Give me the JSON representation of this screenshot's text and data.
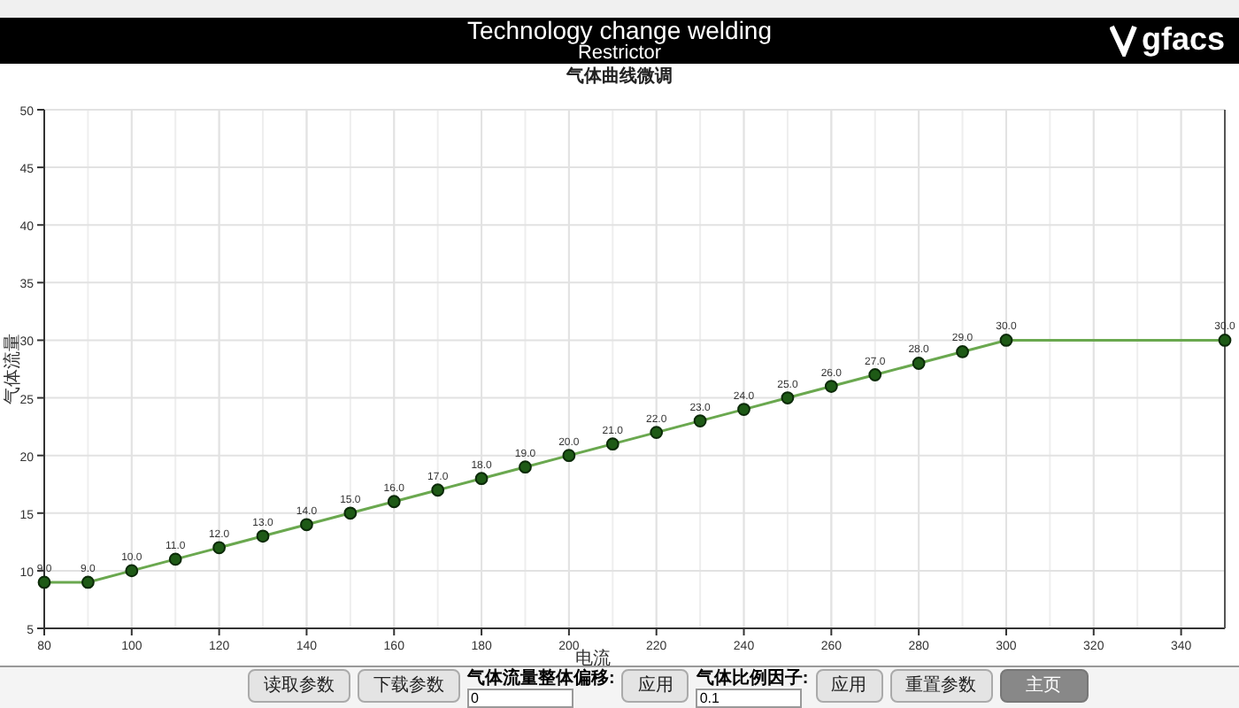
{
  "header": {
    "title": "Technology change welding",
    "subtitle": "Restrictor",
    "logo": "gfacs"
  },
  "chart": {
    "title": "气体曲线微调",
    "chart_data": {
      "type": "line",
      "xlabel": "电流",
      "ylabel": "气体流量",
      "xlim": [
        80,
        350
      ],
      "ylim": [
        5,
        50
      ],
      "xticks": [
        80,
        100,
        120,
        140,
        160,
        180,
        200,
        220,
        240,
        260,
        280,
        300,
        320,
        340
      ],
      "yticks": [
        5,
        10,
        15,
        20,
        25,
        30,
        35,
        40,
        45,
        50
      ],
      "x": [
        80,
        90,
        100,
        110,
        120,
        130,
        140,
        150,
        160,
        170,
        180,
        190,
        200,
        210,
        220,
        230,
        240,
        250,
        260,
        270,
        280,
        290,
        300,
        350
      ],
      "grid": true,
      "value_labels": [
        "9.0",
        "9.0",
        "10.0",
        "11.0",
        "12.0",
        "13.0",
        "14.0",
        "15.0",
        "16.0",
        "17.0",
        "18.0",
        "19.0",
        "20.0",
        "21.0",
        "22.0",
        "23.0",
        "24.0",
        "25.0",
        "26.0",
        "27.0",
        "28.0",
        "29.0",
        "30.0",
        "30.0"
      ],
      "series": [
        {
          "color": "#6aa84f",
          "marker": "circle",
          "values": [
            9,
            9,
            10,
            11,
            12,
            13,
            14,
            15,
            16,
            17,
            18,
            19,
            20,
            21,
            22,
            23,
            24,
            25,
            26,
            27,
            28,
            29,
            30,
            30
          ]
        }
      ]
    }
  },
  "controls": [
    {
      "kind": "button",
      "label": "读取参数",
      "primary": false
    },
    {
      "kind": "button",
      "label": "下载参数",
      "primary": false
    },
    {
      "kind": "field",
      "label": "气体流量整体偏移:",
      "value": "0"
    },
    {
      "kind": "button",
      "label": "应用",
      "primary": false
    },
    {
      "kind": "field",
      "label": "气体比例因子:",
      "value": "0.1"
    },
    {
      "kind": "button",
      "label": "应用",
      "primary": false
    },
    {
      "kind": "button",
      "label": "重置参数",
      "primary": false
    },
    {
      "kind": "button",
      "label": "主页",
      "primary": true
    }
  ]
}
